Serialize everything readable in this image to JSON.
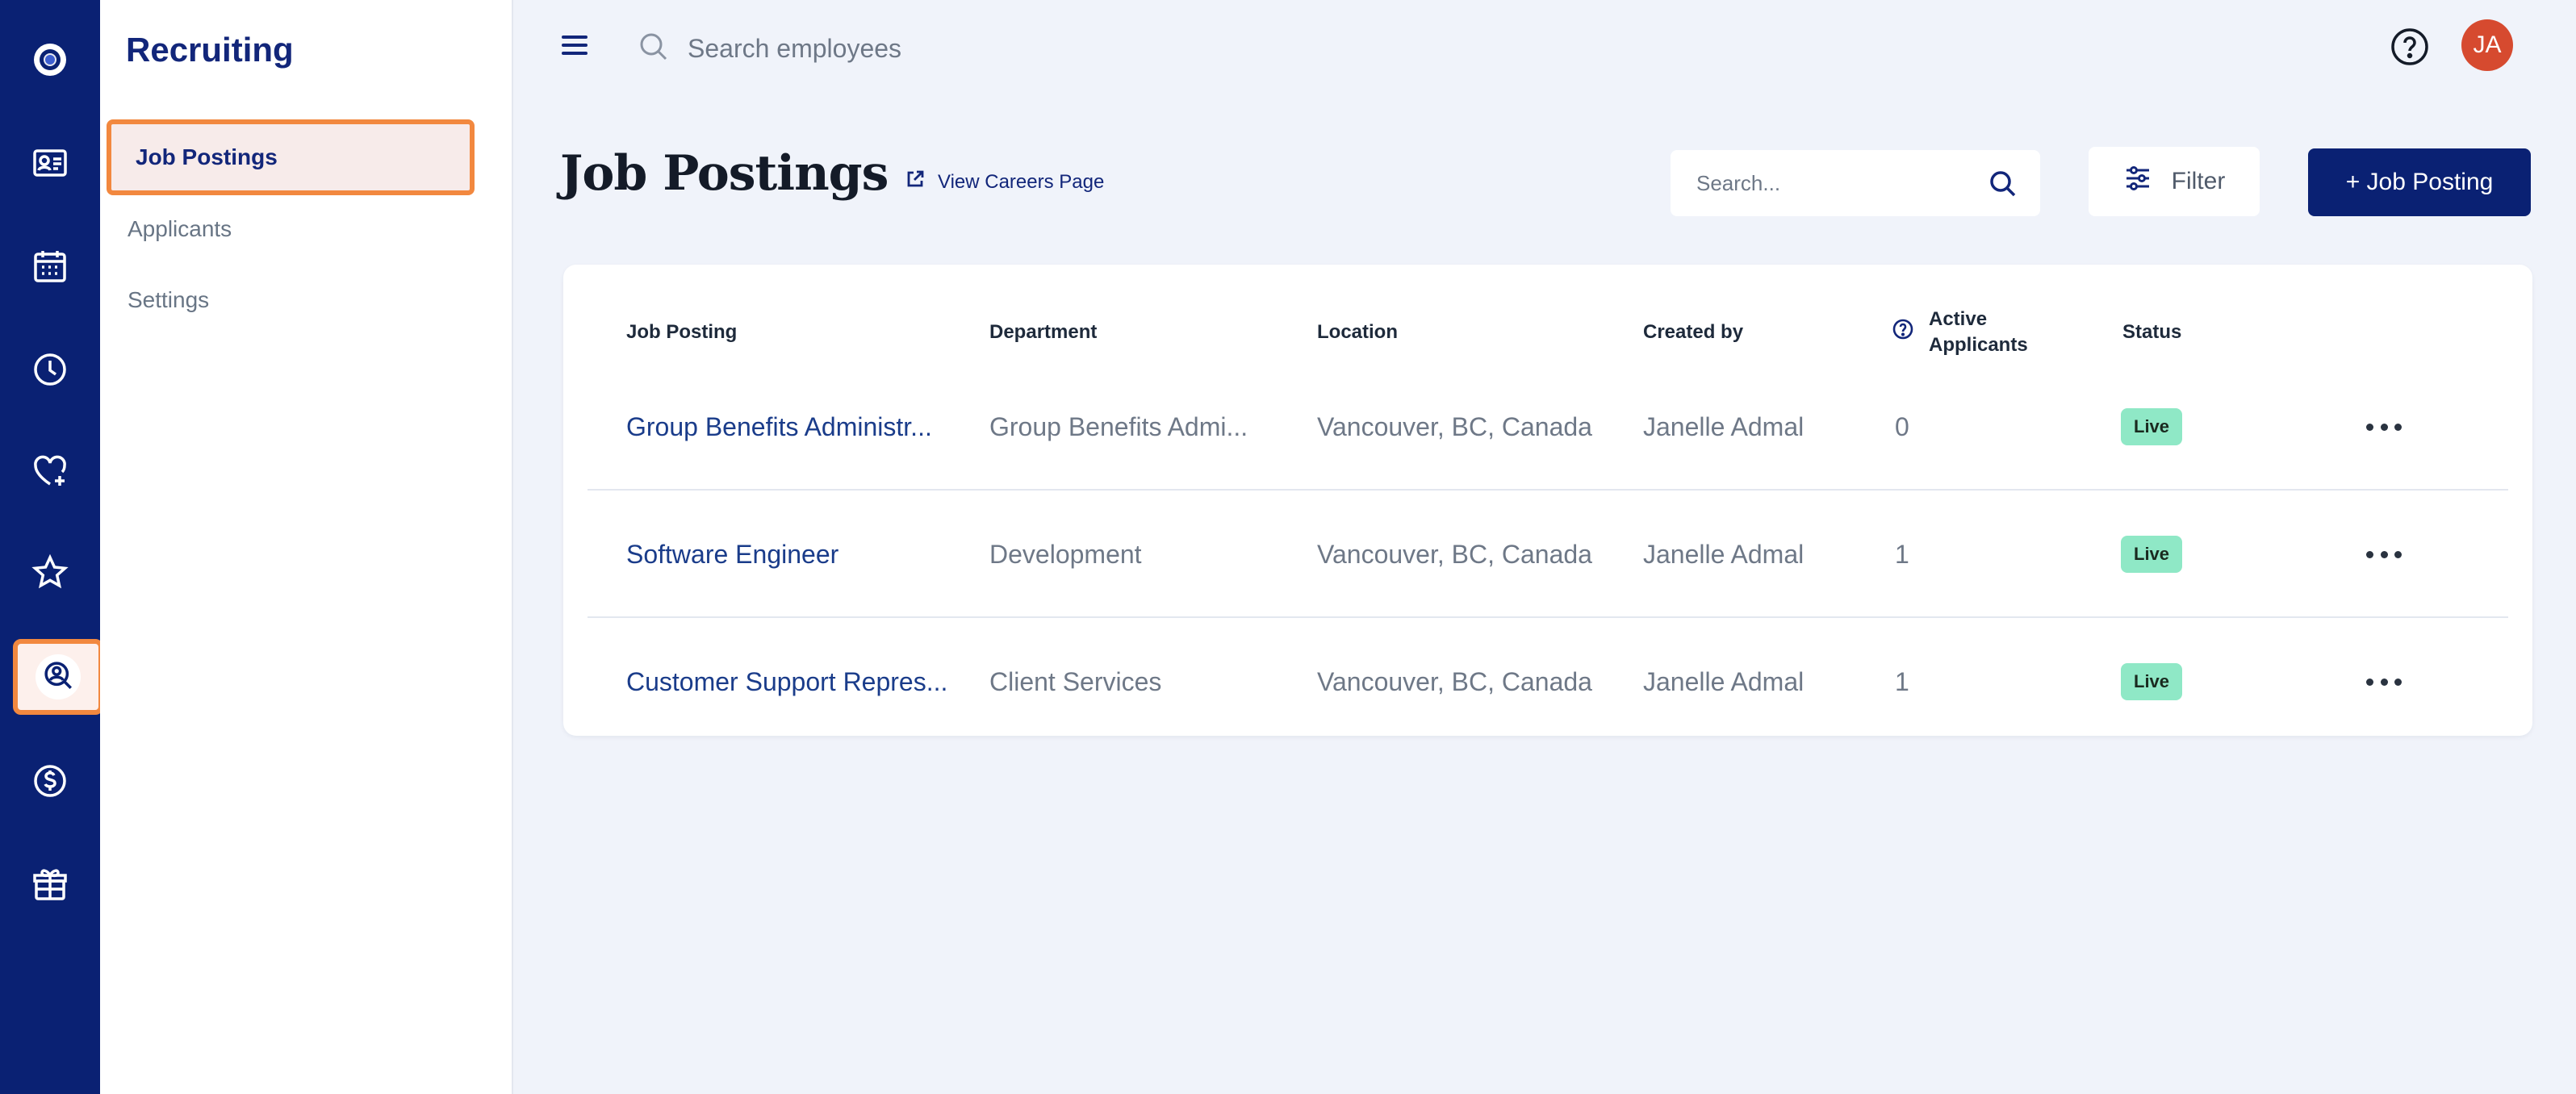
{
  "app": {
    "section_title": "Recruiting"
  },
  "rail": {
    "items": [
      {
        "icon": "logo-icon"
      },
      {
        "icon": "employee-card-icon"
      },
      {
        "icon": "calendar-icon"
      },
      {
        "icon": "clock-icon"
      },
      {
        "icon": "heart-plus-icon"
      },
      {
        "icon": "star-icon"
      },
      {
        "icon": "recruiting-icon",
        "active": true
      },
      {
        "icon": "dollar-icon"
      },
      {
        "icon": "gift-box-icon"
      }
    ]
  },
  "subnav": {
    "items": [
      {
        "label": "Job Postings",
        "active": true
      },
      {
        "label": "Applicants"
      },
      {
        "label": "Settings"
      }
    ]
  },
  "topbar": {
    "search_placeholder": "Search employees",
    "avatar_initials": "JA"
  },
  "page": {
    "title": "Job Postings",
    "careers_link": "View Careers Page",
    "search_placeholder": "Search...",
    "filter_label": "Filter",
    "add_label": "+ Job Posting"
  },
  "table": {
    "headers": {
      "job_posting": "Job Posting",
      "department": "Department",
      "location": "Location",
      "created_by": "Created by",
      "active_applicants_line1": "Active",
      "active_applicants_line2": "Applicants",
      "status": "Status"
    },
    "rows": [
      {
        "job": "Group Benefits Administr...",
        "department": "Group Benefits Admi...",
        "location": "Vancouver, BC, Canada",
        "created_by": "Janelle Admal",
        "applicants": "0",
        "status": "Live"
      },
      {
        "job": "Software Engineer",
        "department": "Development",
        "location": "Vancouver, BC, Canada",
        "created_by": "Janelle Admal",
        "applicants": "1",
        "status": "Live"
      },
      {
        "job": "Customer Support Repres...",
        "department": "Client Services",
        "location": "Vancouver, BC, Canada",
        "created_by": "Janelle Admal",
        "applicants": "1",
        "status": "Live"
      }
    ]
  },
  "colors": {
    "primary": "#0a2173",
    "highlight": "#f2883f",
    "live_badge": "#8fe8c6",
    "avatar": "#d64a2f"
  }
}
